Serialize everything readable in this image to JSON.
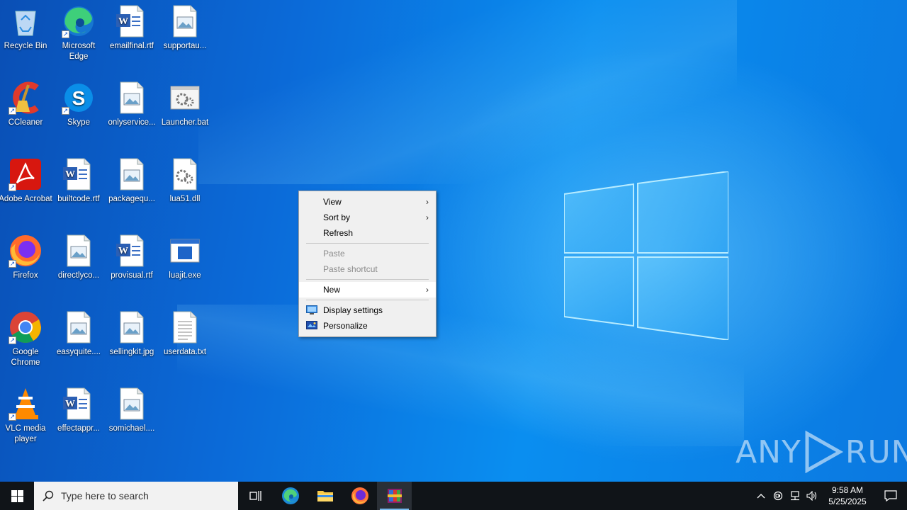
{
  "desktop": {
    "icons": [
      {
        "label": "Recycle Bin",
        "type": "recycle-bin"
      },
      {
        "label": "Microsoft Edge",
        "type": "edge"
      },
      {
        "label": "emailfinal.rtf",
        "type": "word"
      },
      {
        "label": "supportau...",
        "type": "image"
      },
      {
        "label": "CCleaner",
        "type": "ccleaner"
      },
      {
        "label": "Skype",
        "type": "skype"
      },
      {
        "label": "onlyservice...",
        "type": "image"
      },
      {
        "label": "Launcher.bat",
        "type": "bat"
      },
      {
        "label": "Adobe Acrobat",
        "type": "acrobat"
      },
      {
        "label": "builtcode.rtf",
        "type": "word"
      },
      {
        "label": "packagequ...",
        "type": "image"
      },
      {
        "label": "lua51.dll",
        "type": "dll"
      },
      {
        "label": "Firefox",
        "type": "firefox"
      },
      {
        "label": "directlyco...",
        "type": "image"
      },
      {
        "label": "provisual.rtf",
        "type": "word"
      },
      {
        "label": "luajit.exe",
        "type": "exe"
      },
      {
        "label": "Google Chrome",
        "type": "chrome"
      },
      {
        "label": "easyquite....",
        "type": "image"
      },
      {
        "label": "sellingkit.jpg",
        "type": "image"
      },
      {
        "label": "userdata.txt",
        "type": "text"
      },
      {
        "label": "VLC media player",
        "type": "vlc"
      },
      {
        "label": "effectappr...",
        "type": "word"
      },
      {
        "label": "somichael....",
        "type": "image"
      }
    ]
  },
  "context_menu": {
    "view": "View",
    "sort_by": "Sort by",
    "refresh": "Refresh",
    "paste": "Paste",
    "paste_shortcut": "Paste shortcut",
    "new": "New",
    "display_settings": "Display settings",
    "personalize": "Personalize"
  },
  "watermark": {
    "left": "ANY",
    "right": "RUN"
  },
  "taskbar": {
    "search_placeholder": "Type here to search",
    "clock_time": "9:58 AM",
    "clock_date": "5/25/2025"
  },
  "colors": {
    "taskbar_bg": "#101418",
    "menu_bg": "#f0f0f0",
    "accent": "#0a8ef0"
  }
}
